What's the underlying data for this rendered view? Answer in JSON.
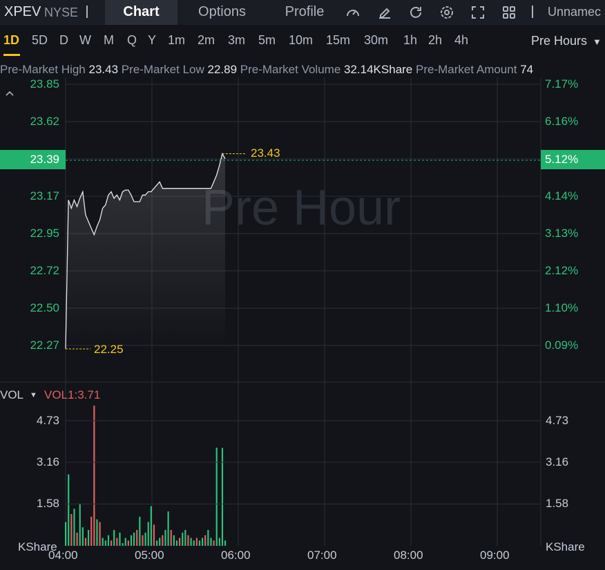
{
  "header": {
    "symbol": "XPEV",
    "exchange": "NYSE",
    "tabs": [
      "Chart",
      "Options",
      "Profile"
    ],
    "active_tab": "Chart",
    "account_name": "Unnamec",
    "icons": [
      "speedometer-icon",
      "draw-icon",
      "refresh-icon",
      "settings-icon",
      "fullscreen-icon",
      "layout-grid-icon"
    ]
  },
  "periods": {
    "items": [
      "1D",
      "5D",
      "D",
      "W",
      "M",
      "Q",
      "Y",
      "1m",
      "2m",
      "3m",
      "5m",
      "10m",
      "15m",
      "30m",
      "1h",
      "2h",
      "4h"
    ],
    "active": "1D",
    "session_select": "Pre Hours"
  },
  "stats": {
    "high_label": "Pre-Market High",
    "high_value": "23.43",
    "low_label": "Pre-Market Low",
    "low_value": "22.89",
    "volume_label": "Pre-Market Volume",
    "volume_value": "32.14KShare",
    "amount_label": "Pre-Market Amount",
    "amount_value": "74"
  },
  "colors": {
    "up": "#2fc07a",
    "down": "#e35f5f",
    "accent": "#f5c518",
    "background": "#12141a"
  },
  "chart_data": [
    {
      "type": "line",
      "watermark": "Pre Hour",
      "y_ticks": [
        "23.85",
        "23.62",
        "23.39",
        "23.17",
        "22.95",
        "22.72",
        "22.50",
        "22.27"
      ],
      "y_pct_ticks": [
        "7.17%",
        "6.16%",
        "5.12%",
        "4.14%",
        "3.13%",
        "2.12%",
        "1.10%",
        "0.09%"
      ],
      "ylim": [
        22.27,
        23.85
      ],
      "current_price": "23.39",
      "current_pct": "5.12%",
      "high_marker": "23.43",
      "low_marker": "22.25",
      "x_ticks": [
        "04:00",
        "05:00",
        "06:00",
        "07:00",
        "08:00",
        "09:00"
      ],
      "x": [
        0,
        1,
        2,
        3,
        4,
        5,
        6,
        7,
        8,
        9,
        10,
        11,
        12,
        13,
        14,
        15,
        16,
        17,
        18,
        19,
        20,
        21,
        22,
        23,
        24,
        25,
        26,
        27,
        28,
        29,
        30,
        31,
        32,
        33,
        34,
        35,
        36,
        37,
        38,
        39,
        40,
        41,
        42,
        43,
        44,
        45,
        46,
        47,
        48,
        49,
        50,
        51,
        52,
        53,
        54,
        55,
        56
      ],
      "y": [
        22.25,
        23.15,
        23.1,
        23.15,
        23.11,
        23.16,
        23.2,
        23.06,
        23.02,
        22.98,
        22.94,
        22.99,
        23.03,
        23.1,
        23.12,
        23.18,
        23.2,
        23.16,
        23.18,
        23.15,
        23.2,
        23.21,
        23.21,
        23.18,
        23.14,
        23.14,
        23.14,
        23.18,
        23.18,
        23.2,
        23.2,
        23.22,
        23.24,
        23.26,
        23.22,
        23.22,
        23.22,
        23.22,
        23.22,
        23.22,
        23.22,
        23.22,
        23.22,
        23.22,
        23.22,
        23.22,
        23.22,
        23.22,
        23.22,
        23.22,
        23.22,
        23.22,
        23.26,
        23.3,
        23.36,
        23.43,
        23.4
      ]
    },
    {
      "type": "bar",
      "title": "VOL",
      "indicator": "VOL1:3.71",
      "unit": "KShare",
      "y_ticks": [
        "4.73",
        "3.16",
        "1.58"
      ],
      "ylim": [
        0,
        5.3
      ],
      "x_ticks": [
        "04:00",
        "05:00",
        "06:00",
        "07:00",
        "08:00",
        "09:00"
      ],
      "x": [
        0,
        1,
        2,
        3,
        4,
        5,
        6,
        7,
        8,
        9,
        10,
        11,
        12,
        13,
        14,
        15,
        16,
        17,
        18,
        19,
        20,
        21,
        22,
        23,
        24,
        25,
        26,
        27,
        28,
        29,
        30,
        31,
        32,
        33,
        34,
        35,
        36,
        37,
        38,
        39,
        40,
        41,
        42,
        43,
        44,
        45,
        46,
        47,
        48,
        49,
        50,
        51,
        52,
        53,
        54,
        55,
        56
      ],
      "values": [
        0.9,
        2.7,
        1.2,
        1.4,
        0.5,
        1.6,
        0.7,
        0.3,
        0.6,
        1.1,
        5.3,
        1.0,
        0.9,
        0.3,
        0.2,
        0.4,
        0.2,
        0.6,
        0.3,
        0.5,
        0.1,
        0.3,
        0.2,
        0.4,
        0.5,
        0.6,
        1.1,
        0.4,
        0.5,
        0.9,
        1.5,
        0.8,
        0.2,
        0.3,
        0.4,
        0.6,
        1.3,
        0.6,
        0.4,
        0.2,
        0.3,
        0.5,
        0.6,
        0.4,
        0.3,
        0.2,
        0.3,
        0.2,
        0.3,
        0.4,
        0.6,
        0.3,
        0.2,
        3.71,
        0.3,
        3.7,
        0.2
      ],
      "colors": [
        "up",
        "up",
        "down",
        "up",
        "down",
        "up",
        "up",
        "down",
        "up",
        "down",
        "down",
        "up",
        "down",
        "up",
        "up",
        "up",
        "down",
        "up",
        "down",
        "up",
        "up",
        "up",
        "down",
        "up",
        "up",
        "down",
        "up",
        "down",
        "up",
        "up",
        "up",
        "down",
        "up",
        "up",
        "down",
        "up",
        "up",
        "down",
        "up",
        "up",
        "down",
        "up",
        "up",
        "down",
        "up",
        "up",
        "down",
        "up",
        "up",
        "down",
        "up",
        "up",
        "down",
        "up",
        "up",
        "up",
        "up"
      ]
    }
  ]
}
